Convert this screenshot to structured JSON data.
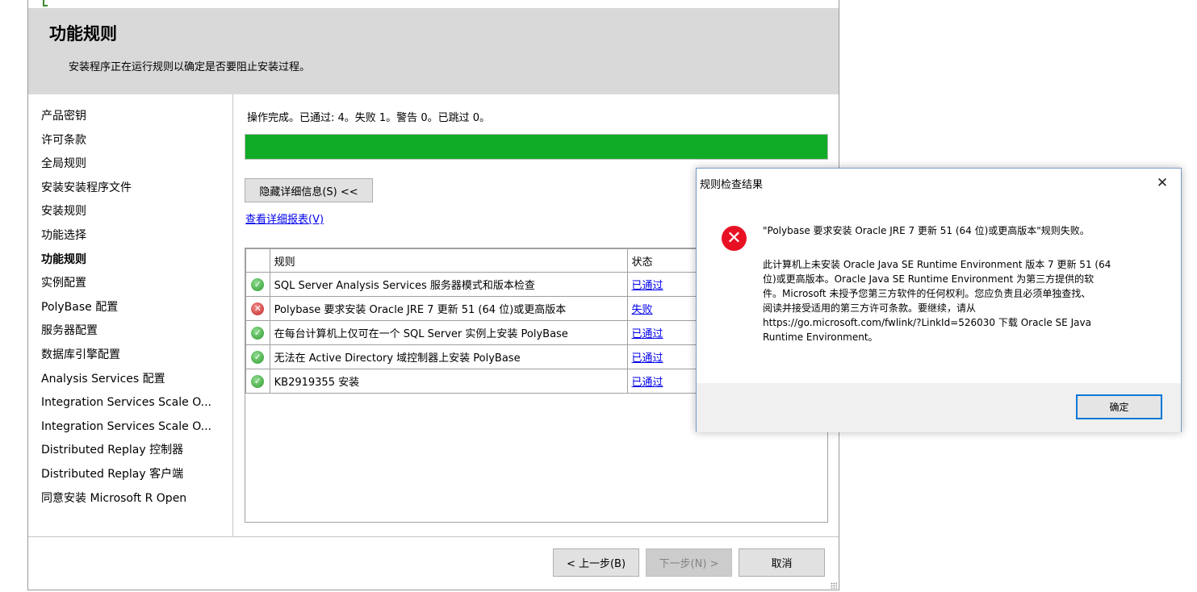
{
  "header": {
    "title": "功能规则",
    "subtitle": "安装程序正在运行规则以确定是否要阻止安装过程。"
  },
  "sidebar": {
    "items": [
      {
        "label": "产品密钥"
      },
      {
        "label": "许可条款"
      },
      {
        "label": "全局规则"
      },
      {
        "label": "安装安装程序文件"
      },
      {
        "label": "安装规则"
      },
      {
        "label": "功能选择"
      },
      {
        "label": "功能规则"
      },
      {
        "label": "实例配置"
      },
      {
        "label": "PolyBase 配置"
      },
      {
        "label": "服务器配置"
      },
      {
        "label": "数据库引擎配置"
      },
      {
        "label": "Analysis Services 配置"
      },
      {
        "label": "Integration Services Scale O..."
      },
      {
        "label": "Integration Services Scale O..."
      },
      {
        "label": "Distributed Replay 控制器"
      },
      {
        "label": "Distributed Replay 客户端"
      },
      {
        "label": "同意安装 Microsoft R Open"
      }
    ],
    "active_label": "功能规则"
  },
  "content": {
    "status_line": "操作完成。已通过: 4。失败 1。警告 0。已跳过 0。",
    "progress_fraction": 1.0,
    "progress_color": "#10ac27",
    "toggle_details_label": "隐藏详细信息(S) <<",
    "view_report_label": "查看详细报表(V)",
    "table": {
      "columns": [
        "规则",
        "状态"
      ],
      "rows": [
        {
          "icon": "check-icon",
          "rule": "SQL Server Analysis Services 服务器模式和版本检查",
          "status": "已通过"
        },
        {
          "icon": "error-icon",
          "rule": "Polybase 要求安装 Oracle JRE 7 更新 51 (64 位)或更高版本",
          "status": "失败"
        },
        {
          "icon": "check-icon",
          "rule": "在每台计算机上仅可在一个 SQL Server 实例上安装 PolyBase",
          "status": "已通过"
        },
        {
          "icon": "check-icon",
          "rule": "无法在 Active Directory 域控制器上安装 PolyBase",
          "status": "已通过"
        },
        {
          "icon": "check-icon",
          "rule": "KB2919355 安装",
          "status": "已通过"
        }
      ]
    }
  },
  "footer": {
    "back_label": "< 上一步(B)",
    "next_label": "下一步(N) >",
    "cancel_label": "取消"
  },
  "dialog": {
    "title": "规则检查结果",
    "close_glyph": "✕",
    "headline": "\"Polybase 要求安装 Oracle JRE 7 更新 51 (64 位)或更高版本\"规则失败。",
    "body_lines": [
      "此计算机上未安装 Oracle Java SE Runtime Environment 版本 7 更新 51 (64",
      "位)或更高版本。Oracle Java SE Runtime Environment 为第三方提供的软",
      "件。Microsoft 未授予您第三方软件的任何权利。您应负责且必须单独查找、",
      "阅读并接受适用的第三方许可条款。要继续，请从",
      "https://go.microsoft.com/fwlink/?LinkId=526030 下载 Oracle SE Java",
      "Runtime Environment。"
    ],
    "ok_label": "确定",
    "error_icon_color": "#e81123"
  }
}
